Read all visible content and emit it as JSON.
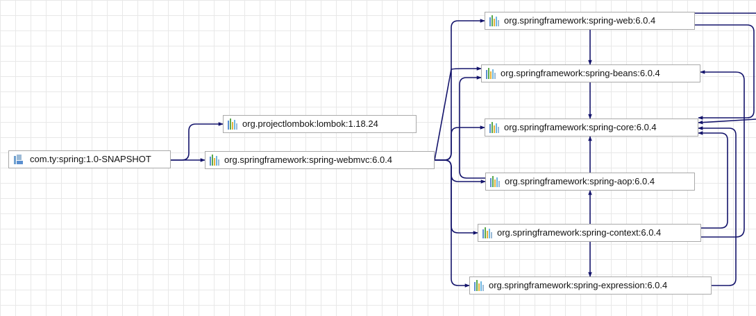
{
  "colors": {
    "edge": "#13136b",
    "node_border": "#a9a9a9",
    "grid": "#e8e8e8"
  },
  "nodes": [
    {
      "id": "root",
      "label": "com.ty:spring:1.0-SNAPSHOT",
      "icon": "module-icon"
    },
    {
      "id": "lombok",
      "label": "org.projectlombok:lombok:1.18.24",
      "icon": "library-icon"
    },
    {
      "id": "webmvc",
      "label": "org.springframework:spring-webmvc:6.0.4",
      "icon": "library-icon"
    },
    {
      "id": "web",
      "label": "org.springframework:spring-web:6.0.4",
      "icon": "library-icon"
    },
    {
      "id": "beans",
      "label": "org.springframework:spring-beans:6.0.4",
      "icon": "library-icon"
    },
    {
      "id": "core",
      "label": "org.springframework:spring-core:6.0.4",
      "icon": "library-icon"
    },
    {
      "id": "aop",
      "label": "org.springframework:spring-aop:6.0.4",
      "icon": "library-icon"
    },
    {
      "id": "context",
      "label": "org.springframework:spring-context:6.0.4",
      "icon": "library-icon"
    },
    {
      "id": "expression",
      "label": "org.springframework:spring-expression:6.0.4",
      "icon": "library-icon"
    }
  ],
  "edges": [
    {
      "from": "root",
      "to": "lombok"
    },
    {
      "from": "root",
      "to": "webmvc"
    },
    {
      "from": "webmvc",
      "to": "web"
    },
    {
      "from": "webmvc",
      "to": "beans"
    },
    {
      "from": "webmvc",
      "to": "core"
    },
    {
      "from": "webmvc",
      "to": "aop"
    },
    {
      "from": "webmvc",
      "to": "context"
    },
    {
      "from": "webmvc",
      "to": "expression"
    },
    {
      "from": "web",
      "to": "beans"
    },
    {
      "from": "web",
      "to": "core"
    },
    {
      "from": "beans",
      "to": "core"
    },
    {
      "from": "aop",
      "to": "beans"
    },
    {
      "from": "aop",
      "to": "core"
    },
    {
      "from": "context",
      "to": "aop"
    },
    {
      "from": "context",
      "to": "beans"
    },
    {
      "from": "context",
      "to": "core"
    },
    {
      "from": "context",
      "to": "expression"
    },
    {
      "from": "expression",
      "to": "core"
    }
  ]
}
